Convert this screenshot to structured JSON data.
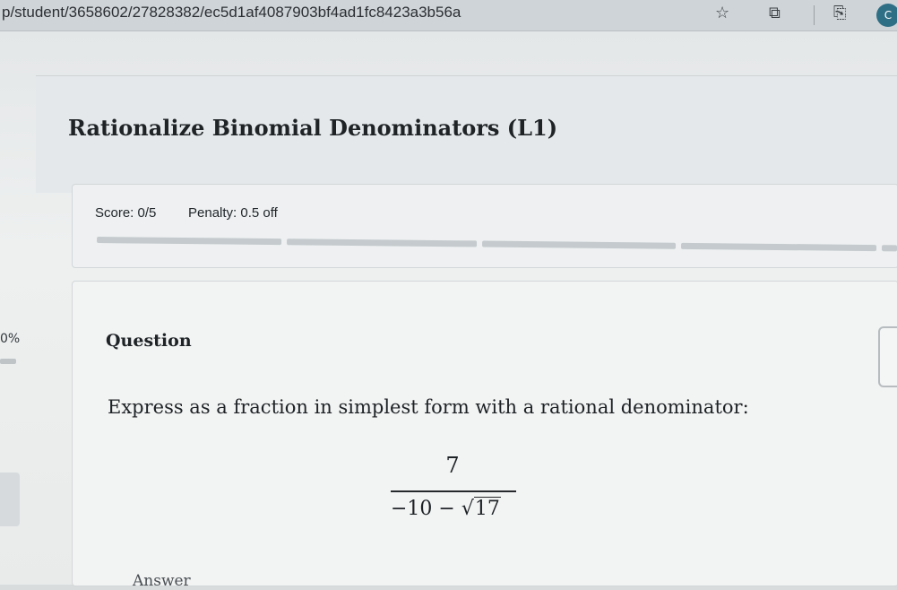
{
  "browser": {
    "url": "p/student/3658602/27828382/ec5d1af4087903bf4ad1fc8423a3b56a",
    "icons": [
      "star-icon",
      "extensions-icon",
      "clipboard-icon",
      "profile-icon"
    ]
  },
  "page": {
    "title": "Rationalize Binomial Denominators (L1)",
    "score": "Score: 0/5",
    "penalty": "Penalty: 0.5 off",
    "side_percent": "0%",
    "question_label": "Question",
    "instruction": "Express as a fraction in simplest form with a rational denominator:",
    "fraction": {
      "numerator": "7",
      "denominator_prefix": "−10 − ",
      "sqrt_symbol": "√",
      "radicand": "17"
    },
    "answer_label": "Answer"
  }
}
